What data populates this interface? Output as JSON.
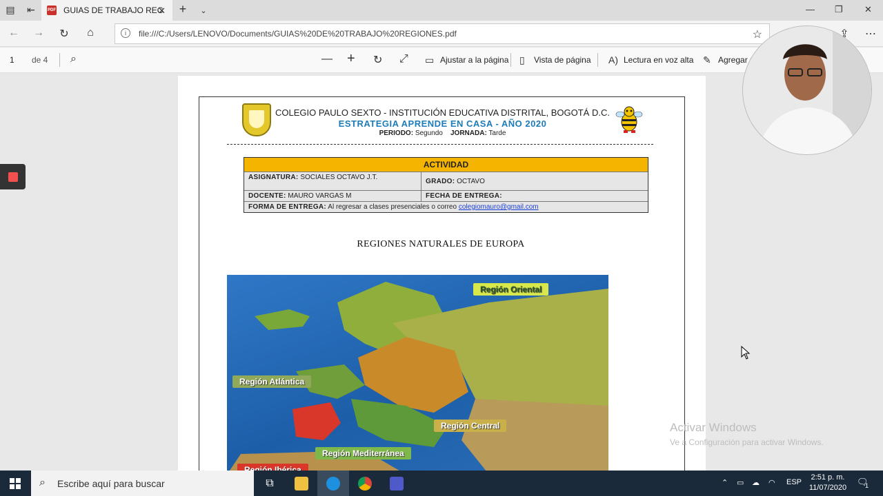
{
  "browser": {
    "tab_title": "GUIAS DE TRABAJO REC",
    "tab_close": "✕",
    "new_tab": "+",
    "url": "file:///C:/Users/LENOVO/Documents/GUIAS%20DE%20TRABAJO%20REGIONES.pdf"
  },
  "pdf_toolbar": {
    "page_number": "1",
    "page_total": "de 4",
    "fit_label": "Ajustar a la página",
    "page_view_label": "Vista de página",
    "read_aloud_label": "Lectura en voz alta",
    "add_notes_label": "Agregar n"
  },
  "document": {
    "header_line1": "COLEGIO PAULO SEXTO - INSTITUCIÓN EDUCATIVA DISTRITAL, BOGOTÁ D.C.",
    "header_line2": "ESTRATEGIA APRENDE EN CASA - AÑO 2020",
    "periodo_label": "PERIODO:",
    "periodo_value": "Segundo",
    "jornada_label": "JORNADA:",
    "jornada_value": "Tarde",
    "table": {
      "actividad": "ACTIVIDAD",
      "asignatura_label": "ASIGNATURA:",
      "asignatura_value": "SOCIALES OCTAVO J.T.",
      "grado_label": "GRADO:",
      "grado_value": "OCTAVO",
      "docente_label": "DOCENTE:",
      "docente_value": "MAURO VARGAS M",
      "fecha_label": "FECHA DE ENTREGA:",
      "forma_label": "FORMA DE ENTREGA:",
      "forma_value": "Al regresar a clases presenciales o correo",
      "email": "colegiomauro@gmail.com"
    },
    "section_title": "REGIONES NATURALES DE EUROPA",
    "map_labels": {
      "oriental": "Región Oriental",
      "atlantica": "Región Atlántica",
      "central": "Región Central",
      "mediterranea": "Región Mediterránea",
      "iberica": "Región Ibérica"
    }
  },
  "watermark": {
    "line1": "Activar Windows",
    "line2": "Ve a Configuración para activar Windows."
  },
  "taskbar": {
    "search_placeholder": "Escribe aquí para buscar",
    "language": "ESP",
    "time": "2:51 p. m.",
    "date": "11/07/2020",
    "notification_count": "1"
  },
  "colors": {
    "actividad_bg": "#f4b400",
    "header_blue": "#1c7bb8",
    "taskbar": "#1b2a3a"
  }
}
